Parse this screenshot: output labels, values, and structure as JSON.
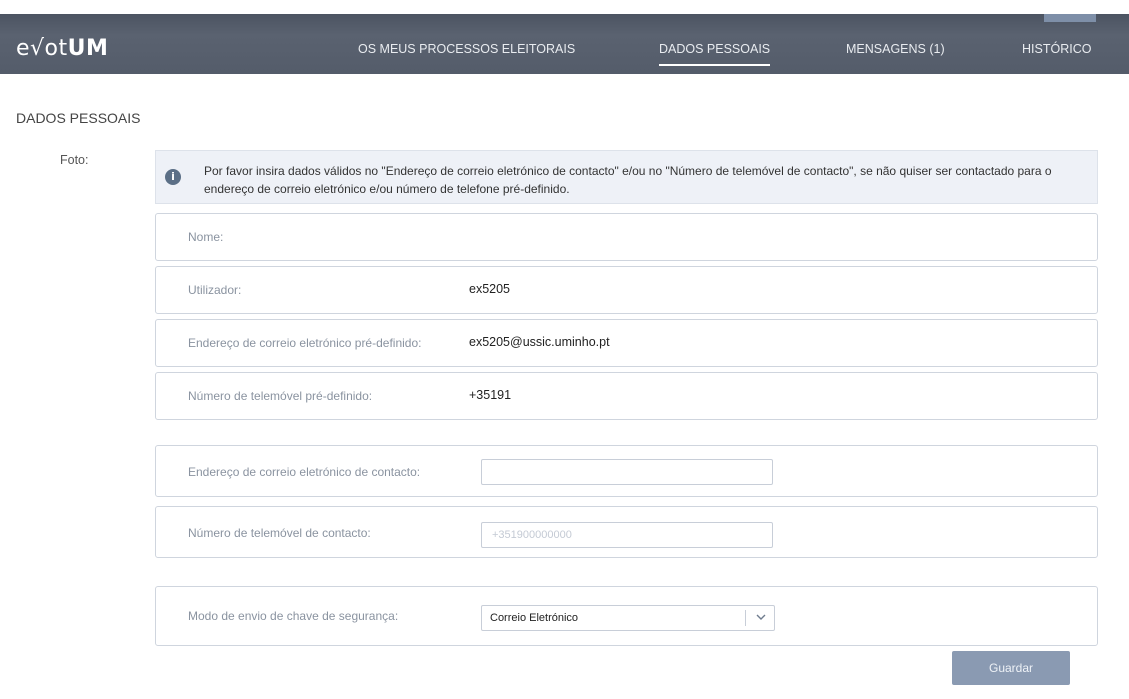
{
  "header": {
    "logo_prefix": "e√ot",
    "logo_bold": "UM",
    "nav": [
      {
        "label": "OS MEUS PROCESSOS ELEITORAIS"
      },
      {
        "label": "DADOS PESSOAIS"
      },
      {
        "label": "MENSAGENS (1)"
      },
      {
        "label": "HISTÓRICO"
      }
    ]
  },
  "page": {
    "title": "DADOS PESSOAIS",
    "foto_label": "Foto:",
    "info": "Por favor insira dados válidos no \"Endereço de correio eletrónico de contacto\" e/ou no \"Número de telemóvel de contacto\", se não quiser ser contactado para o endereço de correio eletrónico e/ou número de telefone pré-definido."
  },
  "fields": {
    "nome": {
      "label": "Nome:",
      "value": ""
    },
    "utilizador": {
      "label": "Utilizador:",
      "value": "ex5205"
    },
    "email_default": {
      "label": "Endereço de correio eletrónico pré-definido:",
      "value": "ex5205@ussic.uminho.pt"
    },
    "phone_default": {
      "label": "Número de telemóvel pré-definido:",
      "value": "+35191"
    },
    "email_contact": {
      "label": "Endereço de correio eletrónico de contacto:",
      "value": "",
      "placeholder": ""
    },
    "phone_contact": {
      "label": "Número de telemóvel de contacto:",
      "value": "",
      "placeholder": "+351900000000"
    },
    "security_mode": {
      "label": "Modo de envio de chave de segurança:",
      "selected": "Correio Eletrónico"
    }
  },
  "actions": {
    "save_label": "Guardar"
  },
  "colors": {
    "navbar": "#545c6a",
    "button": "#8a9ab2",
    "info_bg": "#eef1f7"
  },
  "icons": {
    "info": "info-circle-icon",
    "dropdown": "chevron-down-icon"
  }
}
